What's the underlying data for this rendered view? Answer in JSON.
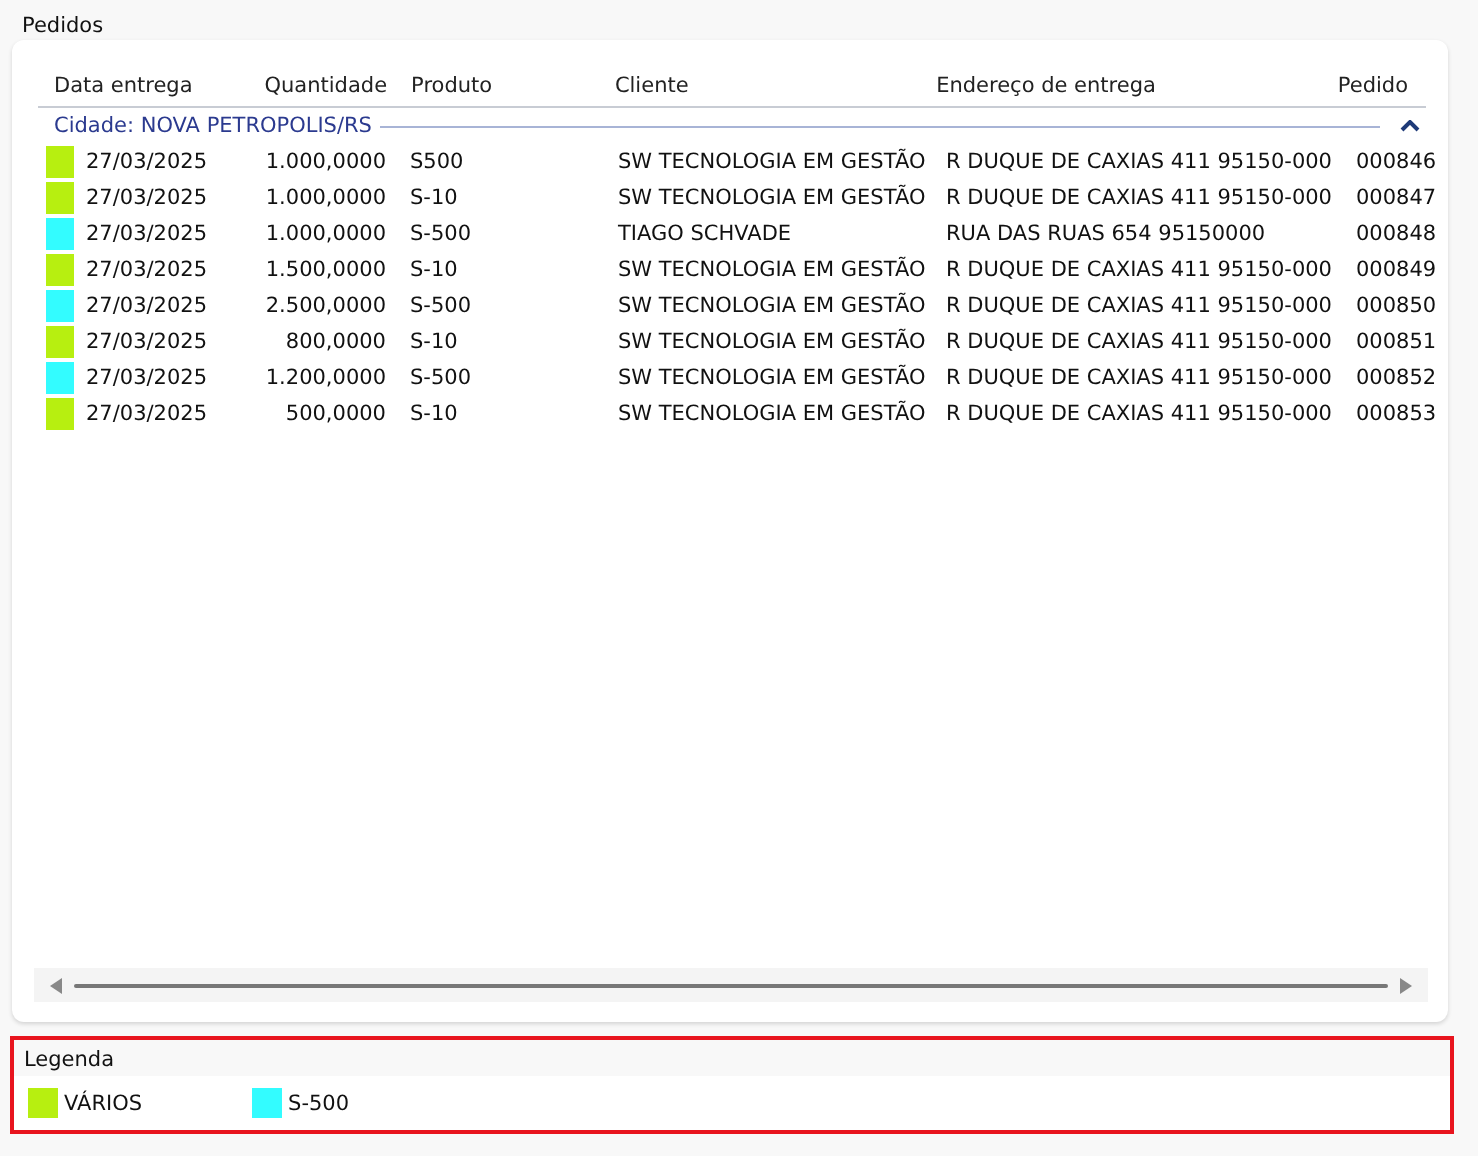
{
  "panel": {
    "title": "Pedidos"
  },
  "table": {
    "columns": [
      "Data entrega",
      "Quantidade",
      "Produto",
      "Cliente",
      "Endereço de entrega",
      "Pedido"
    ],
    "group": {
      "label": "Cidade: NOVA PETROPOLIS/RS",
      "expanded": true
    },
    "rows": [
      {
        "color": "#b7ef10",
        "cells": [
          "27/03/2025",
          "1.000,0000",
          "S500",
          "SW TECNOLOGIA EM GESTÃO",
          "R DUQUE DE CAXIAS 411 95150-000",
          "000846"
        ]
      },
      {
        "color": "#b7ef10",
        "cells": [
          "27/03/2025",
          "1.000,0000",
          "S-10",
          "SW TECNOLOGIA EM GESTÃO",
          "R DUQUE DE CAXIAS 411 95150-000",
          "000847"
        ]
      },
      {
        "color": "#33fcff",
        "cells": [
          "27/03/2025",
          "1.000,0000",
          "S-500",
          "TIAGO SCHVADE",
          "RUA DAS RUAS 654 95150000",
          "000848"
        ]
      },
      {
        "color": "#b7ef10",
        "cells": [
          "27/03/2025",
          "1.500,0000",
          "S-10",
          "SW TECNOLOGIA EM GESTÃO",
          "R DUQUE DE CAXIAS 411 95150-000",
          "000849"
        ]
      },
      {
        "color": "#33fcff",
        "cells": [
          "27/03/2025",
          "2.500,0000",
          "S-500",
          "SW TECNOLOGIA EM GESTÃO",
          "R DUQUE DE CAXIAS 411 95150-000",
          "000850"
        ]
      },
      {
        "color": "#b7ef10",
        "cells": [
          "27/03/2025",
          "800,0000",
          "S-10",
          "SW TECNOLOGIA EM GESTÃO",
          "R DUQUE DE CAXIAS 411 95150-000",
          "000851"
        ]
      },
      {
        "color": "#33fcff",
        "cells": [
          "27/03/2025",
          "1.200,0000",
          "S-500",
          "SW TECNOLOGIA EM GESTÃO",
          "R DUQUE DE CAXIAS 411 95150-000",
          "000852"
        ]
      },
      {
        "color": "#b7ef10",
        "cells": [
          "27/03/2025",
          "500,0000",
          "S-10",
          "SW TECNOLOGIA EM GESTÃO",
          "R DUQUE DE CAXIAS 411 95150-000",
          "000853"
        ]
      }
    ]
  },
  "legend": {
    "title": "Legenda",
    "items": [
      {
        "color": "#b7ef10",
        "label": "VÁRIOS"
      },
      {
        "color": "#33fcff",
        "label": "S-500"
      }
    ]
  }
}
